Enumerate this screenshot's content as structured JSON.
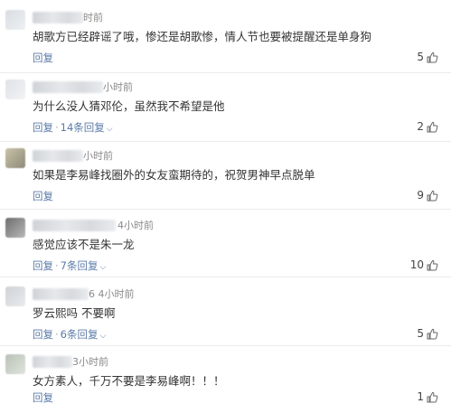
{
  "comments": [
    {
      "time": "时前",
      "text": "胡歌方已经辟谣了哦，惨还是胡歌惨，情人节也要被提醒还是单身狗",
      "reply_label": "回复",
      "replies_label": "",
      "likes": "5"
    },
    {
      "time": "小时前",
      "text": "为什么没人猜邓伦，虽然我不希望是他",
      "reply_label": "回复",
      "replies_label": "14条回复",
      "likes": "2"
    },
    {
      "time": "小时前",
      "text": "如果是李易峰找圈外的女友蛮期待的，祝贺男神早点脱单",
      "reply_label": "回复",
      "replies_label": "",
      "likes": "9"
    },
    {
      "time": "4小时前",
      "text": "感觉应该不是朱一龙",
      "reply_label": "回复",
      "replies_label": "7条回复",
      "likes": "10"
    },
    {
      "time": "6 4小时前",
      "text": "罗云熙吗 不要啊",
      "reply_label": "回复",
      "replies_label": "6条回复",
      "likes": "5"
    },
    {
      "time": "3小时前",
      "text": "女方素人，千万不要是李易峰啊！！！",
      "reply_label": "回复",
      "replies_label": "",
      "likes": "1"
    }
  ],
  "colors": {
    "link": "#5b7ba8",
    "text": "#333333",
    "meta": "#8a8a8a"
  },
  "icons": {
    "like": "thumbs-up-icon",
    "expand": "chevron-down-icon"
  }
}
